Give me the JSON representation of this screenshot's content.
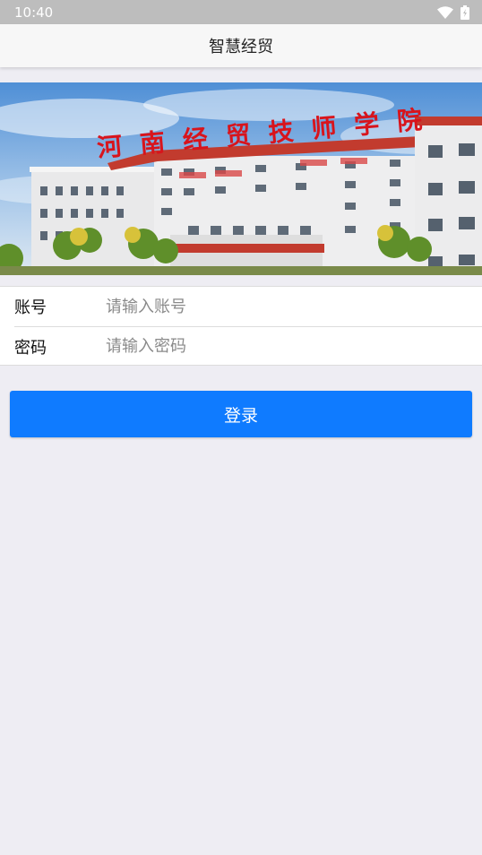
{
  "status_bar": {
    "time": "10:40",
    "icons": [
      "wifi-icon",
      "battery-icon"
    ]
  },
  "app_bar": {
    "title": "智慧经贸"
  },
  "banner": {
    "sign_text": "河南经贸技师学院"
  },
  "form": {
    "account": {
      "label": "账号",
      "placeholder": "请输入账号",
      "value": ""
    },
    "password": {
      "label": "密码",
      "placeholder": "请输入密码",
      "value": ""
    }
  },
  "login_button": {
    "label": "登录"
  },
  "colors": {
    "accent": "#0f7bff",
    "status_bar": "#bdbdbd",
    "background": "#eeedf3",
    "app_bar": "#f7f7f7"
  }
}
